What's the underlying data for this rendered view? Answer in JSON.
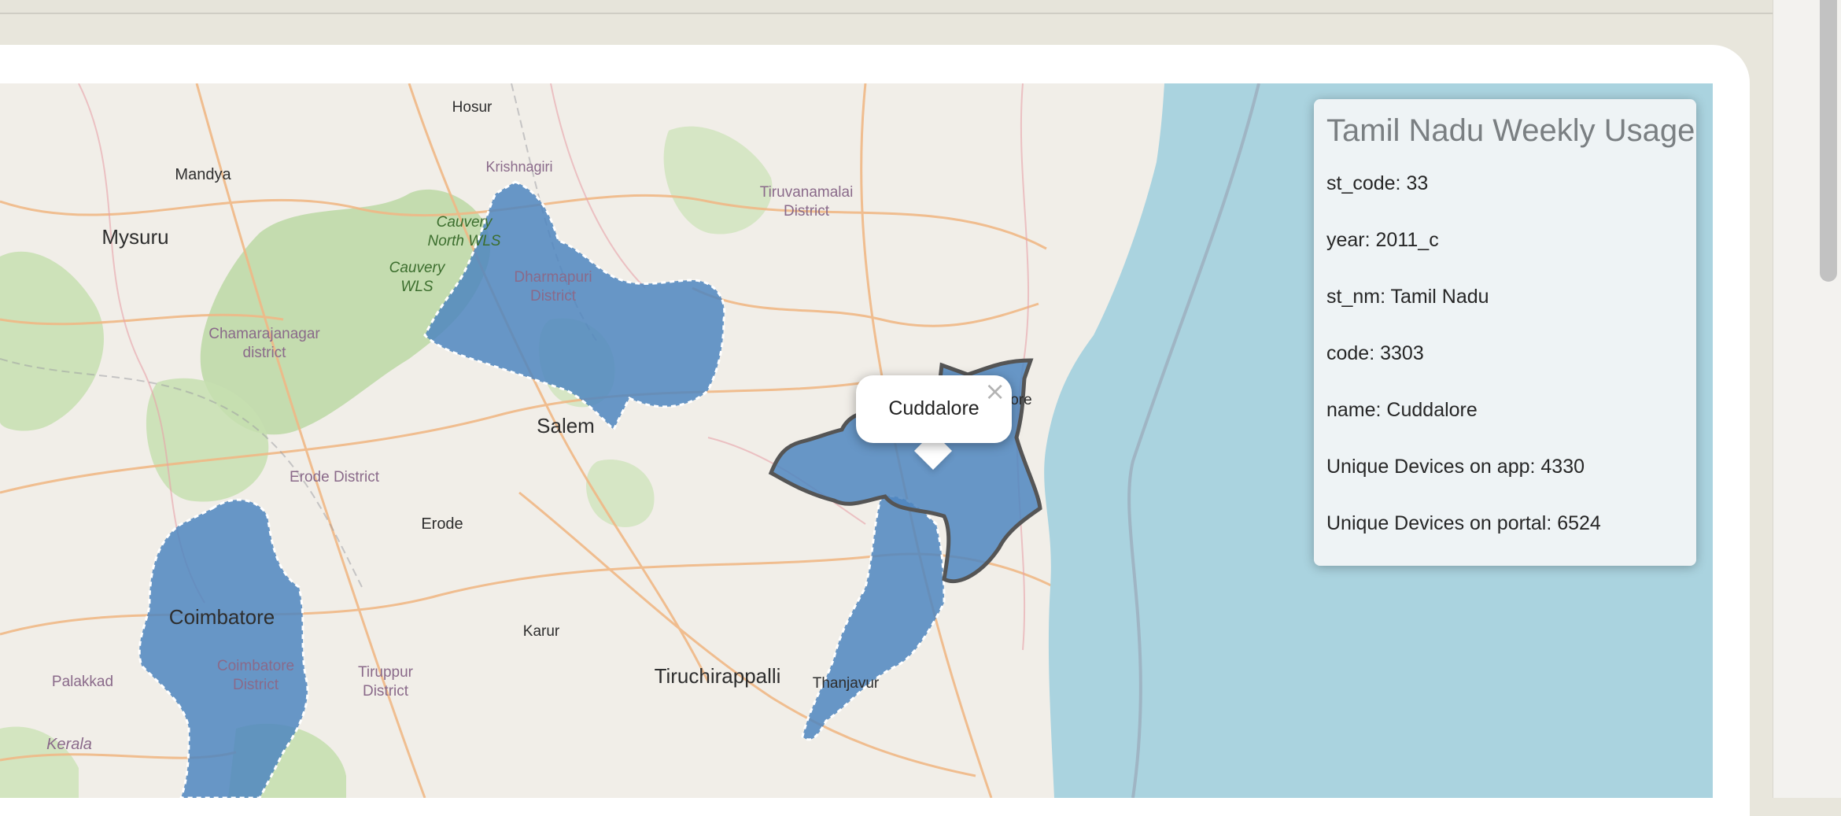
{
  "info_panel": {
    "title": "Tamil Nadu Weekly Usage",
    "rows": [
      "st_code: 33",
      "year: 2011_c",
      "st_nm: Tamil Nadu",
      "code: 3303",
      "name: Cuddalore",
      "Unique Devices on app: 4330",
      "Unique Devices on portal: 6524"
    ]
  },
  "popup": {
    "content": "Cuddalore",
    "close_glyph": "×"
  },
  "map_labels": {
    "hosur": "Hosur",
    "krishnagiri": "Krishnagiri",
    "mandya": "Mandya",
    "mysuru": "Mysuru",
    "cauvery_north_1": "Cauvery",
    "cauvery_north_2": "North WLS",
    "cauvery_wls_1": "Cauvery",
    "cauvery_wls_2": "WLS",
    "dharmapuri_1": "Dharmapuri",
    "dharmapuri_2": "District",
    "tiruvanamalai_1": "Tiruvanamalai",
    "tiruvanamalai_2": "District",
    "chamarajanagar_1": "Chamarajanagar",
    "chamarajanagar_2": "district",
    "salem": "Salem",
    "erode_district": "Erode District",
    "erode": "Erode",
    "cuddalore_partial": "lore",
    "coimbatore": "Coimbatore",
    "coimbatore_district_1": "Coimbatore",
    "coimbatore_district_2": "District",
    "karur": "Karur",
    "tiruppur_1": "Tiruppur",
    "tiruppur_2": "District",
    "palakkad": "Palakkad",
    "kerala": "Kerala",
    "tiruchirappalli": "Tiruchirappalli",
    "thanjavur": "Thanjavur"
  },
  "colors": {
    "highlight_fill": "#4f86c0",
    "selected_stroke": "#555555",
    "sea": "#aad3df",
    "land": "#f1eee8",
    "forest": "#bcd8a4",
    "road": "#f0b886"
  }
}
